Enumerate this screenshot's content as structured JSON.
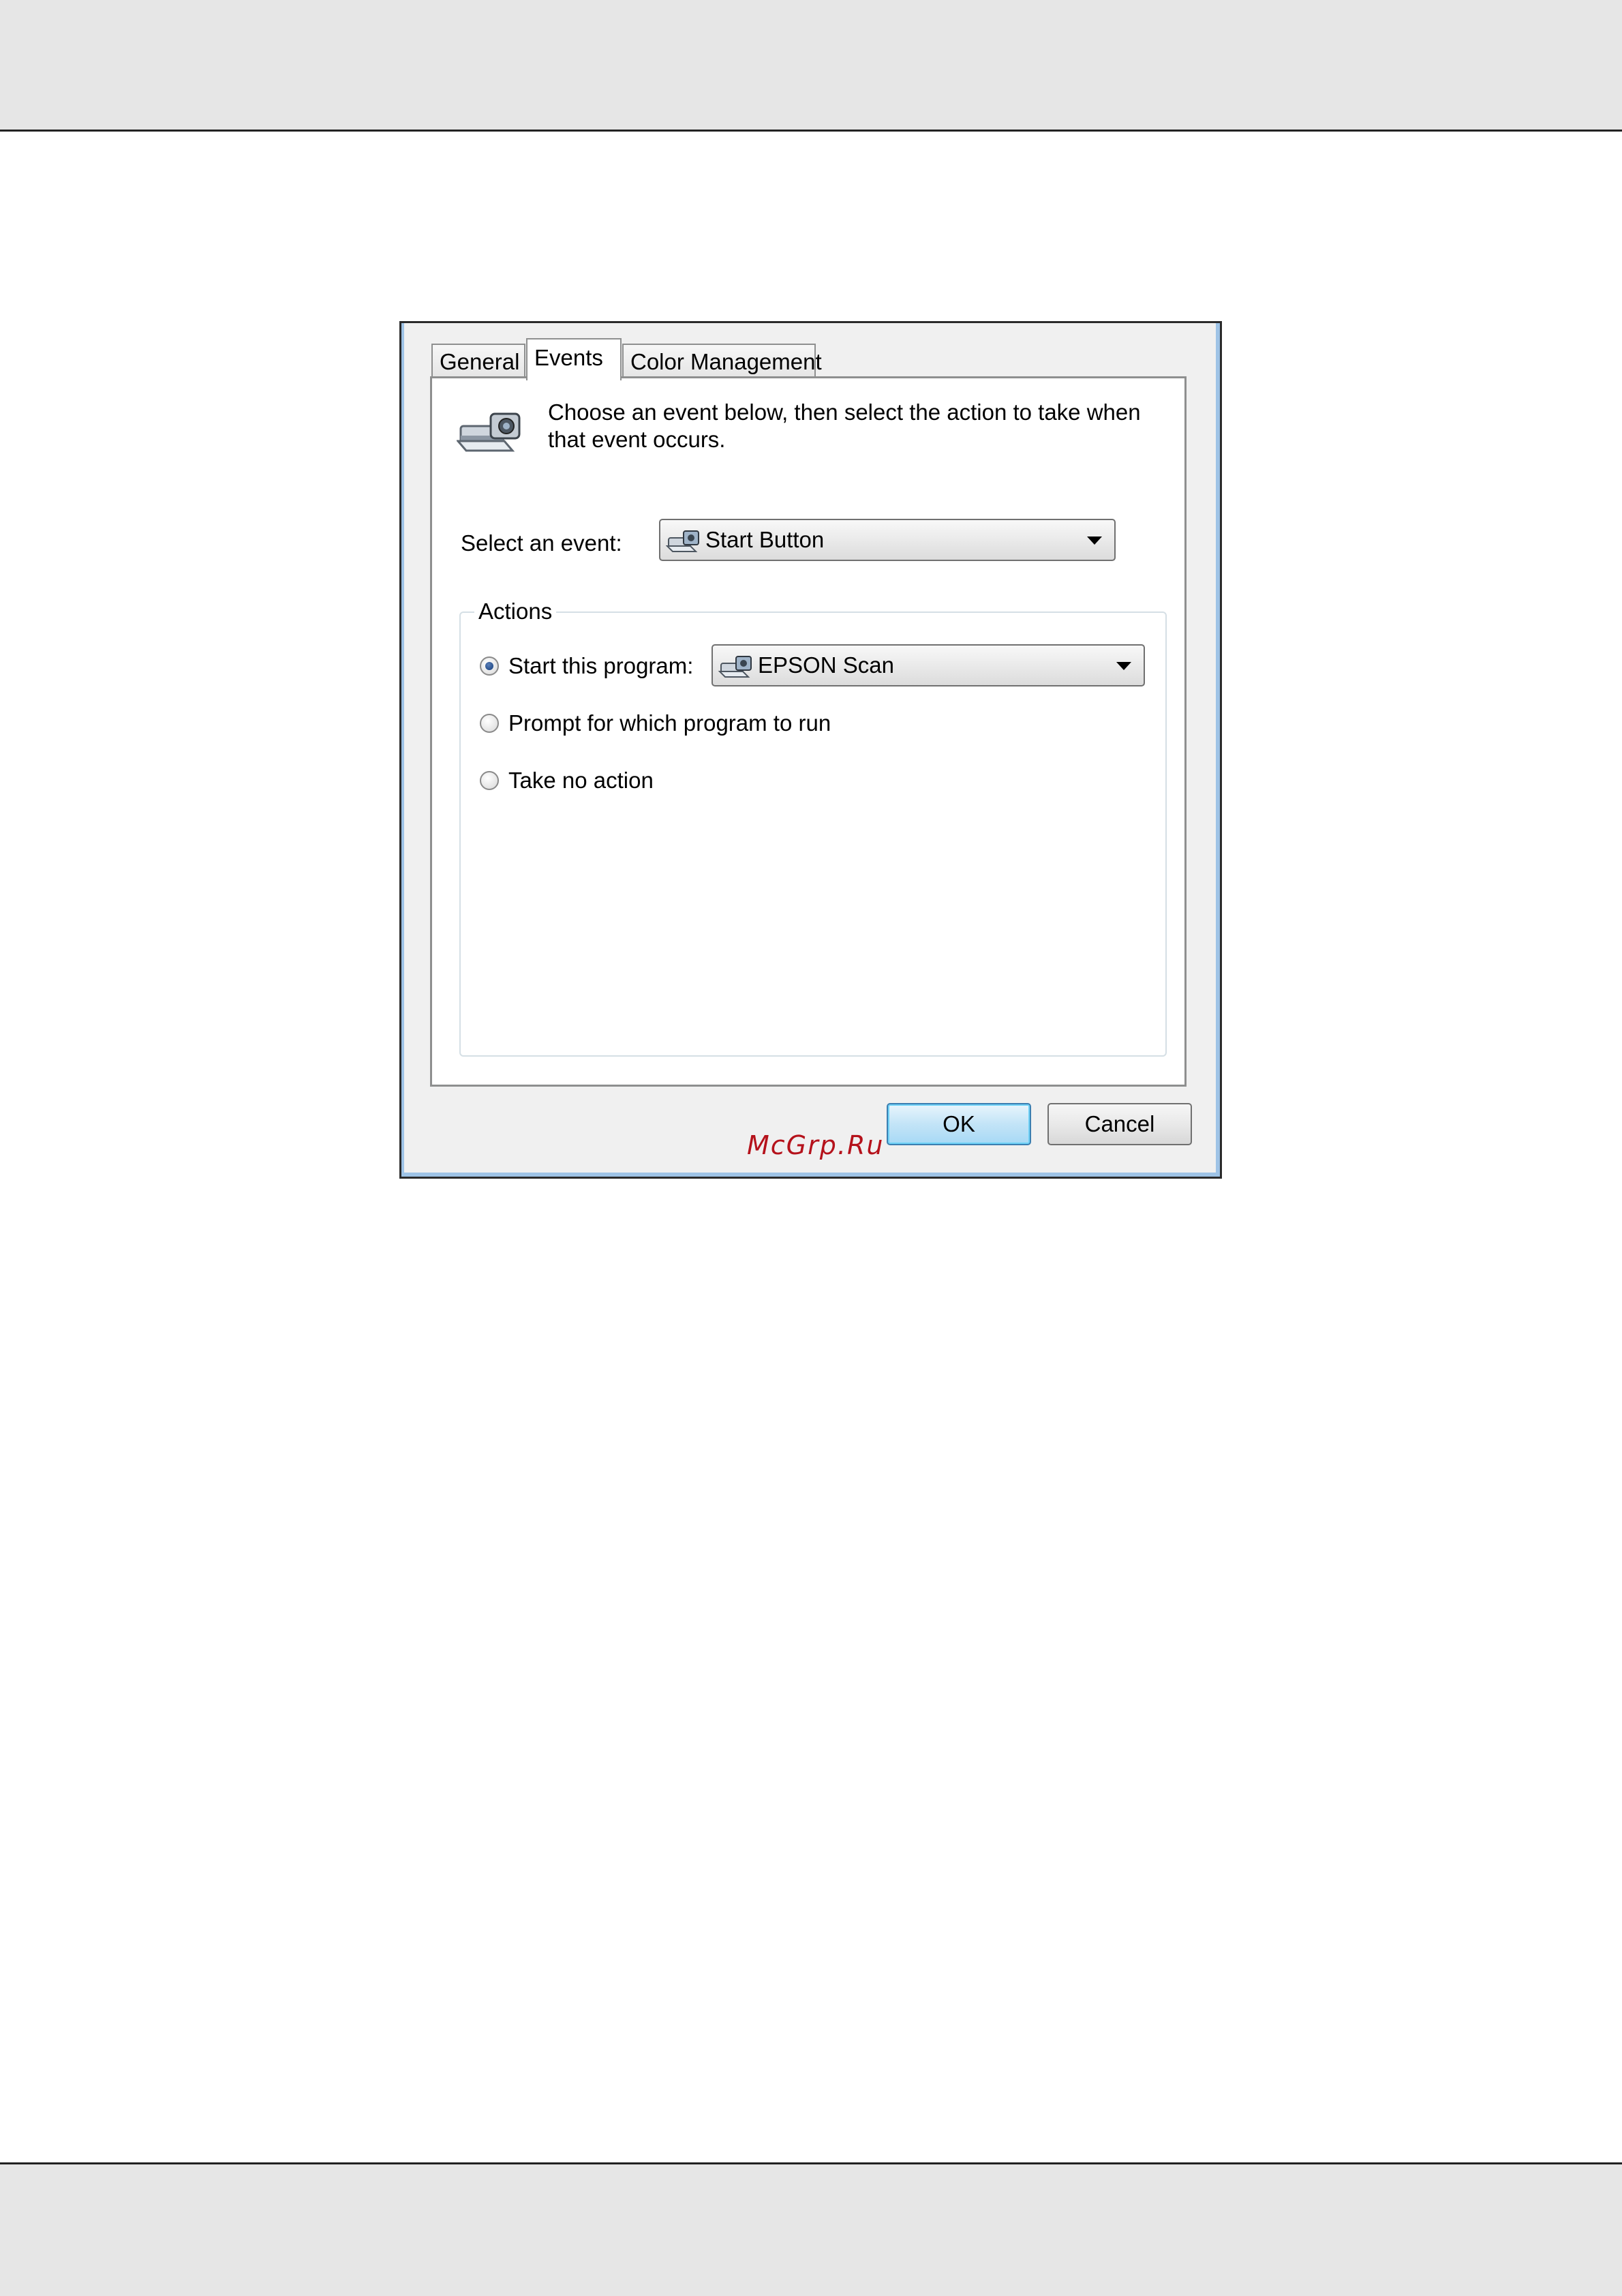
{
  "dialog": {
    "tabs": [
      {
        "label": "General",
        "active": false
      },
      {
        "label": "Events",
        "active": true
      },
      {
        "label": "Color Management",
        "active": false
      }
    ],
    "intro_text": "Choose an event below, then select the action to take when that event occurs.",
    "select_event_label": "Select an event:",
    "event_value": "Start Button",
    "actions": {
      "title": "Actions",
      "start_program_label": "Start this program:",
      "start_program_selected": true,
      "program_value": "EPSON Scan",
      "prompt_label": "Prompt for which program to run",
      "prompt_selected": false,
      "no_action_label": "Take no action",
      "no_action_selected": false
    },
    "ok_label": "OK",
    "cancel_label": "Cancel"
  },
  "watermark": "McGrp.Ru",
  "icons": {
    "event_header": "scanner-icon",
    "event_combo": "scanner-icon",
    "program_combo": "scanner-icon",
    "combo_arrow": "chevron-down-icon"
  },
  "colors": {
    "window_border": "#9ec3e6",
    "ok_button": "#a7d9f5",
    "radio_dot": "#123b7a",
    "watermark": "#b5121b"
  }
}
